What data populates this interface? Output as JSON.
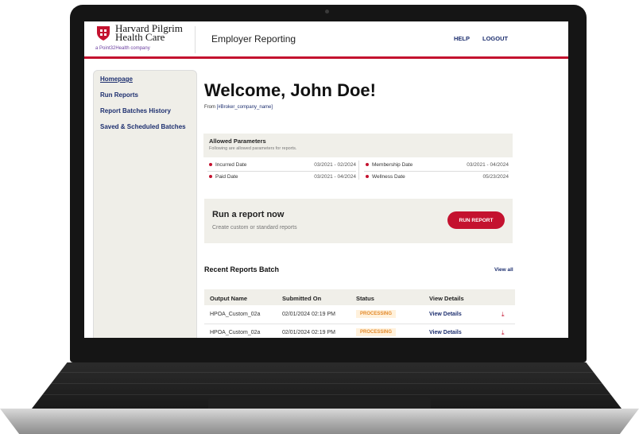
{
  "header": {
    "logo_line1": "Harvard Pilgrim",
    "logo_line2": "Health Care",
    "logo_sub": "a Point32Health company",
    "app_title": "Employer Reporting",
    "nav": [
      "HELP",
      "LOGOUT"
    ]
  },
  "sidebar": {
    "items": [
      {
        "label": "Homepage"
      },
      {
        "label": "Run Reports"
      },
      {
        "label": "Report Batches History"
      },
      {
        "label": "Saved & Scheduled Batches"
      }
    ]
  },
  "main": {
    "welcome": "Welcome, John Doe!",
    "from_label": "From",
    "from_value": "[#Broker_company_name]"
  },
  "params": {
    "title": "Allowed Parameters",
    "subtitle": "Following are allowed parameters for reports.",
    "items": [
      {
        "label": "Incurred Date",
        "value": "03/2021 - 02/2024"
      },
      {
        "label": "Paid Date",
        "value": "03/2021 - 04/2024"
      },
      {
        "label": "Membership Date",
        "value": "03/2021 - 04/2024"
      },
      {
        "label": "Wellness Date",
        "value": "05/23/2024"
      }
    ]
  },
  "run": {
    "title": "Run a report now",
    "subtitle": "Create custom or standard reports",
    "button": "RUN REPORT"
  },
  "recent": {
    "title": "Recent Reports Batch",
    "view_all": "View all",
    "columns": [
      "Output Name",
      "Submitted On",
      "Status",
      "View Details"
    ],
    "rows": [
      {
        "name": "HPOA_Custom_02a",
        "submitted": "02/01/2024 02:19 PM",
        "status": "PROCESSING",
        "details": "View Details"
      },
      {
        "name": "HPOA_Custom_02a",
        "submitted": "02/01/2024 02:19 PM",
        "status": "PROCESSING",
        "details": "View Details"
      }
    ]
  },
  "colors": {
    "brand_red": "#c4122f",
    "nav_blue": "#1d2f6f",
    "panel": "#f0efe9",
    "status_orange": "#e38b2c"
  },
  "icons": [
    "shield-logo-icon",
    "download-icon"
  ]
}
